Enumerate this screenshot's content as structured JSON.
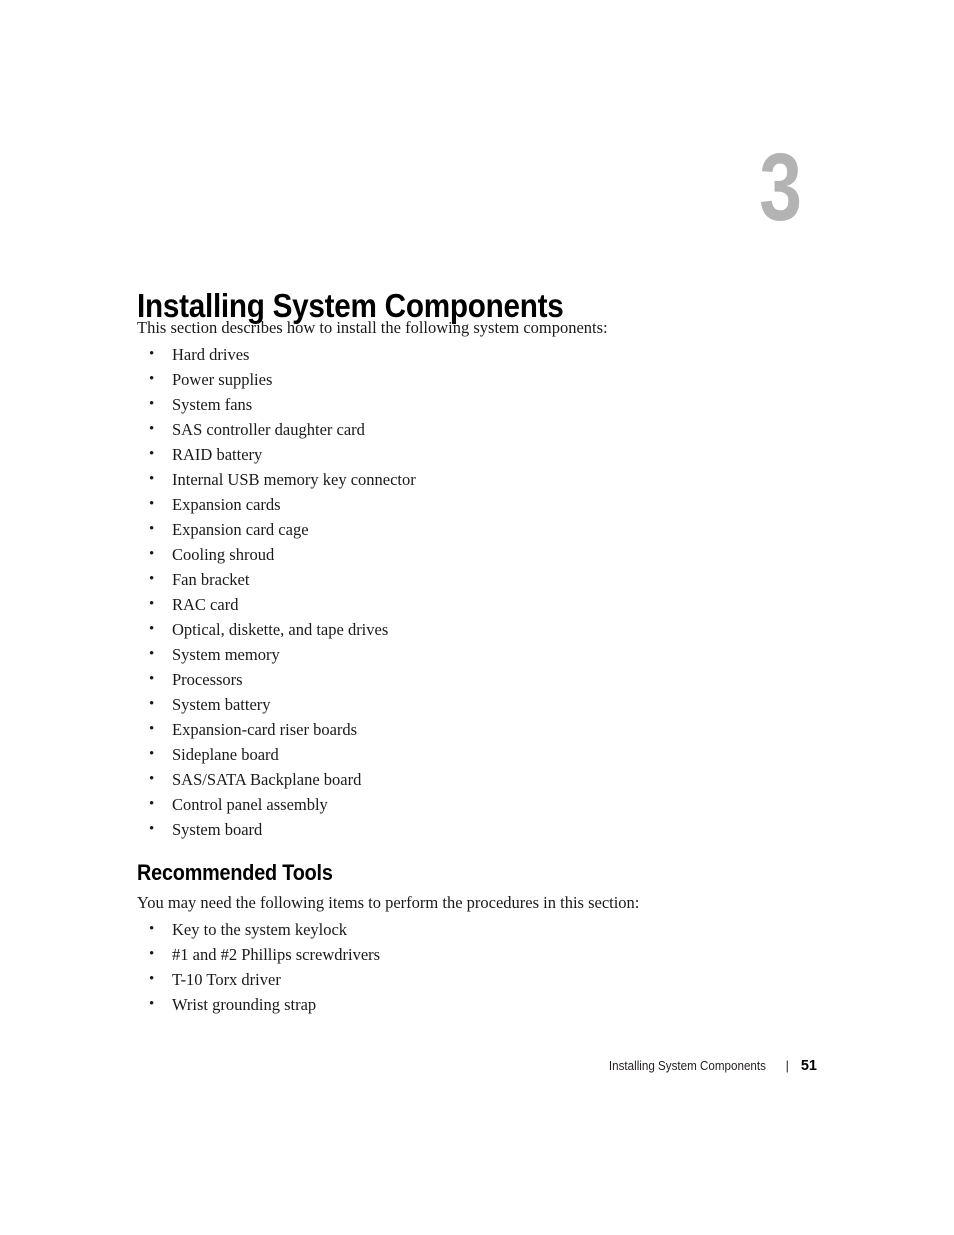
{
  "chapter": {
    "number": "3",
    "title": "Installing System Components"
  },
  "intro": "This section describes how to install the following system components:",
  "components": [
    "Hard drives",
    "Power supplies",
    "System fans",
    "SAS controller daughter card",
    "RAID battery",
    "Internal USB memory key connector",
    "Expansion cards",
    "Expansion card cage",
    "Cooling shroud",
    "Fan bracket",
    "RAC card",
    "Optical, diskette, and tape drives",
    "System memory",
    "Processors",
    "System battery",
    "Expansion-card riser boards",
    "Sideplane board",
    "SAS/SATA Backplane board",
    "Control panel assembly",
    "System board"
  ],
  "recommended_tools": {
    "heading": "Recommended Tools",
    "intro": "You may need the following items to perform the procedures in this section:",
    "items": [
      "Key to the system keylock",
      "#1 and #2 Phillips screwdrivers",
      "T-10 Torx driver",
      "Wrist grounding strap"
    ]
  },
  "footer": {
    "title": "Installing System Components",
    "separator": "|",
    "page_number": "51"
  },
  "bullet_glyph": "•",
  "colors": {
    "chapter_number": "#b3b3b3",
    "body_text": "#1a1a1a",
    "heading_text": "#000000",
    "page_background": "#ffffff"
  }
}
